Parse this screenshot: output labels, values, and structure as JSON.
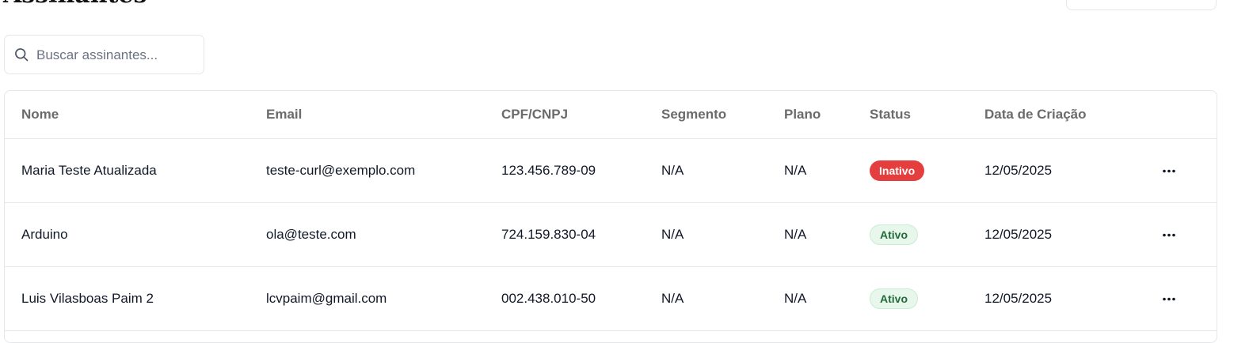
{
  "page": {
    "title": "Assinantes"
  },
  "search": {
    "placeholder": "Buscar assinantes...",
    "value": ""
  },
  "table": {
    "columns": [
      "Nome",
      "Email",
      "CPF/CNPJ",
      "Segmento",
      "Plano",
      "Status",
      "Data de Criação"
    ],
    "rows": [
      {
        "nome": "Maria Teste Atualizada",
        "email": "teste-curl@exemplo.com",
        "cpf": "123.456.789-09",
        "segmento": "N/A",
        "plano": "N/A",
        "status": "Inativo",
        "data": "12/05/2025"
      },
      {
        "nome": "Arduino",
        "email": "ola@teste.com",
        "cpf": "724.159.830-04",
        "segmento": "N/A",
        "plano": "N/A",
        "status": "Ativo",
        "data": "12/05/2025"
      },
      {
        "nome": "Luis Vilasboas Paim 2",
        "email": "lcvpaim@gmail.com",
        "cpf": "002.438.010-50",
        "segmento": "N/A",
        "plano": "N/A",
        "status": "Ativo",
        "data": "12/05/2025"
      }
    ]
  },
  "icons": {
    "search": "search-icon",
    "row_actions": "more-horizontal-icon"
  },
  "colors": {
    "inactive_badge": "#e53e3e",
    "active_badge_bg": "#e7f7ec",
    "active_badge_text": "#236b3a",
    "border": "#e5e7eb",
    "header_text": "#6b6b6b"
  }
}
